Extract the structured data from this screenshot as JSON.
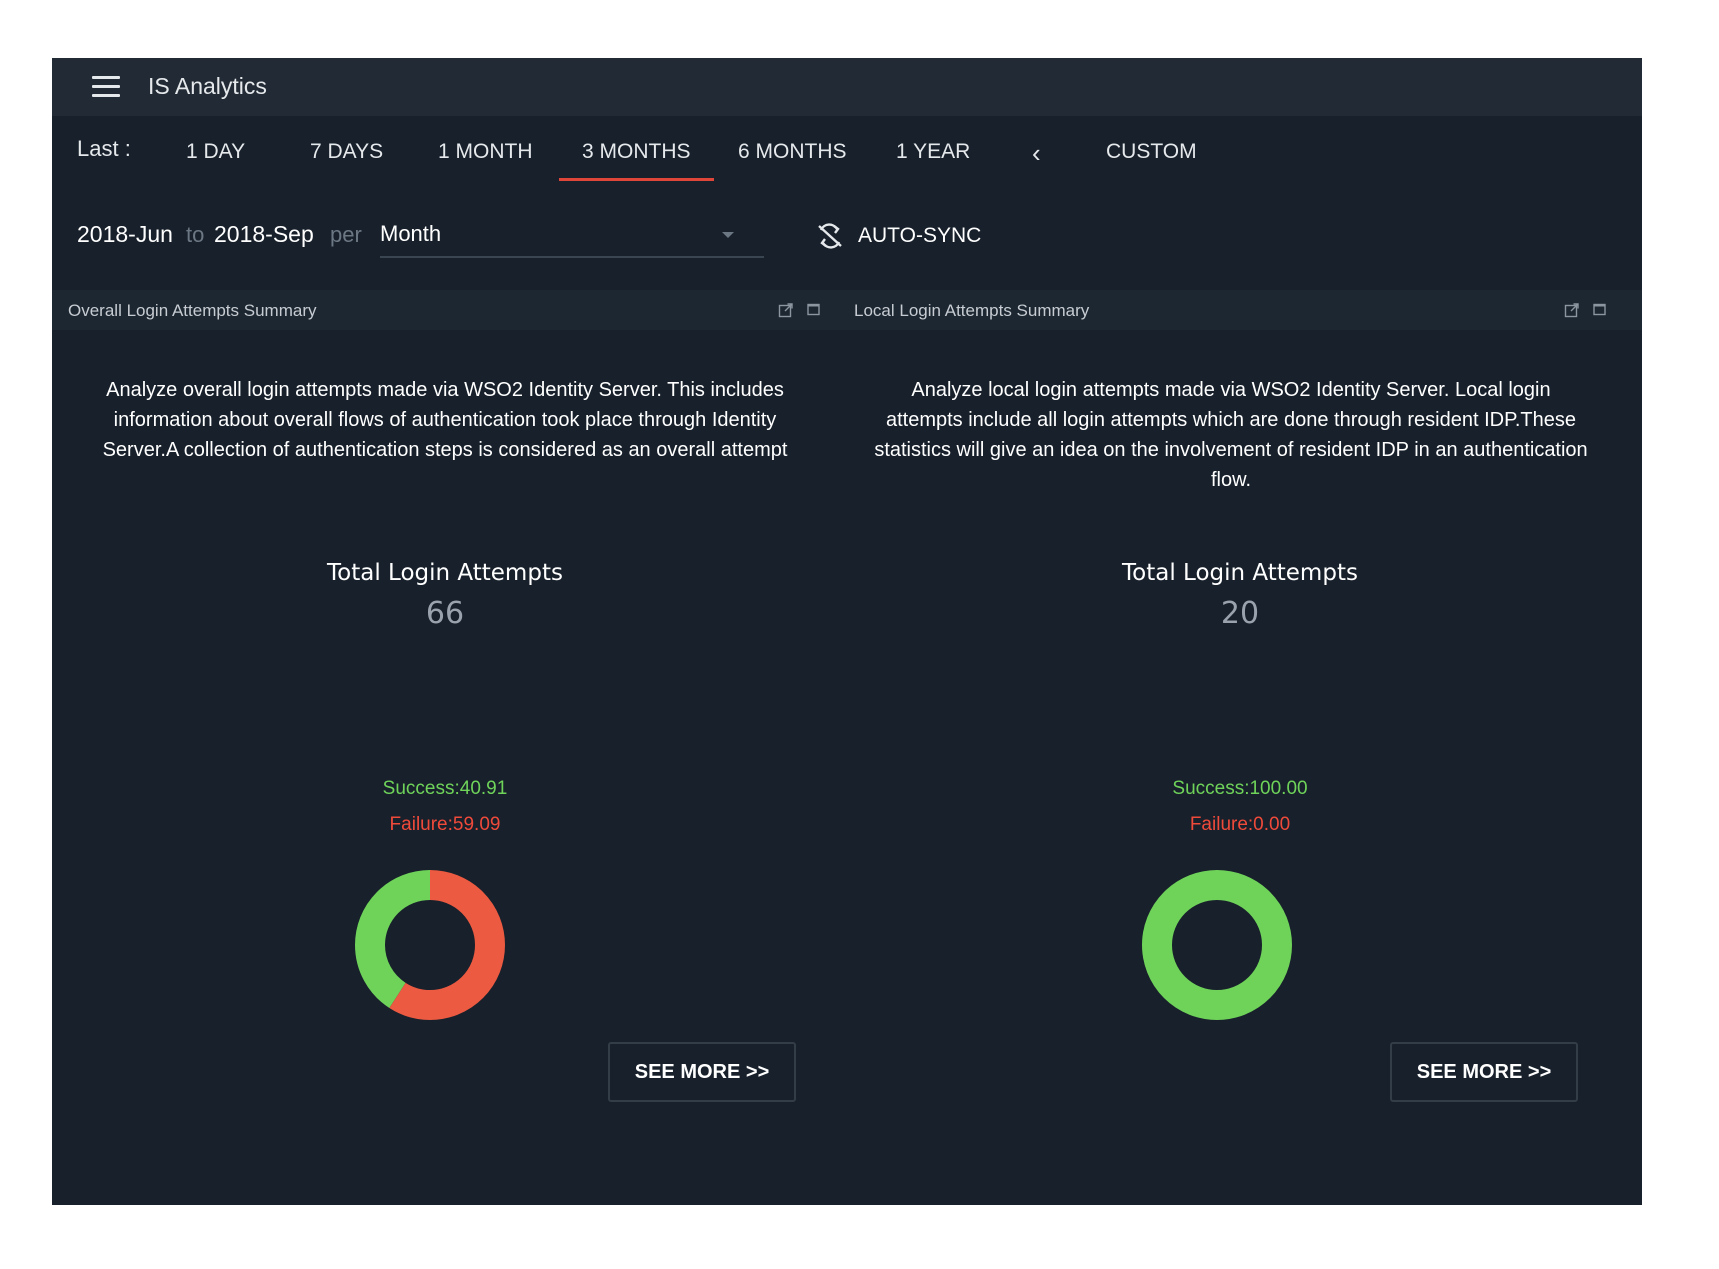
{
  "app": {
    "title": "IS Analytics"
  },
  "filter": {
    "last_label": "Last :",
    "ranges": [
      "1 DAY",
      "7 DAYS",
      "1 MONTH",
      "3 MONTHS",
      "6 MONTHS",
      "1 YEAR"
    ],
    "active_range": "3 MONTHS",
    "prev_icon": "chevron-left-icon",
    "custom": "CUSTOM"
  },
  "daterange": {
    "from": "2018-Jun",
    "to_sep": "to",
    "to": "2018-Sep",
    "per_sep": "per",
    "granularity": "Month",
    "autosync_icon": "sync-disabled-icon",
    "autosync_label": "AUTO-SYNC"
  },
  "widgets": [
    {
      "title": "Overall Login Attempts Summary",
      "description": "Analyze overall login attempts made via WSO2 Identity Server. This includes information about overall flows of authentication took place through Identity Server.A collection of authentication steps is considered as an overall attempt",
      "total_label": "Total Login Attempts",
      "total_value": "66",
      "success_text": "Success:40.91",
      "failure_text": "Failure:59.09",
      "success_pct": 40.91,
      "failure_pct": 59.09,
      "see_more": "SEE MORE >>"
    },
    {
      "title": "Local Login Attempts Summary",
      "description": "Analyze local login attempts made via WSO2 Identity Server. Local login attempts include all login attempts which are done through resident IDP.These statistics will give an idea on the involvement of resident IDP in an authentication flow.",
      "total_label": "Total Login Attempts",
      "total_value": "20",
      "success_text": "Success:100.00",
      "failure_text": "Failure:0.00",
      "success_pct": 100.0,
      "failure_pct": 0.0,
      "see_more": "SEE MORE >>"
    }
  ],
  "colors": {
    "success": "#6fd35a",
    "failure": "#eb5a41",
    "background": "#17202b",
    "accent": "#e0453a"
  }
}
